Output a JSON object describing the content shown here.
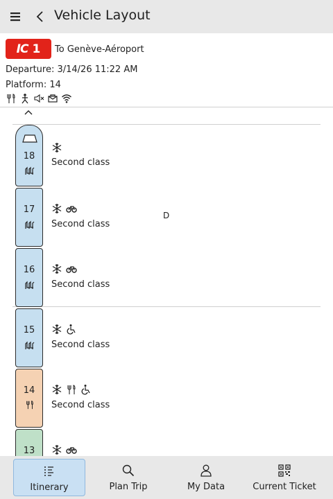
{
  "header": {
    "title": "Vehicle Layout",
    "menu_icon": "hamburger-menu-icon",
    "back_icon": "chevron-left-icon"
  },
  "train": {
    "line_logo": {
      "brand": "IC",
      "number": "1",
      "color": "#e2231a"
    },
    "destination": "To Genève-Aéroport",
    "departure": "Departure: 3/14/26 11:22 AM",
    "platform": "Platform: 14",
    "amenities": [
      "restaurant-icon",
      "family-zone-icon",
      "quiet-zone-icon",
      "business-zone-icon",
      "wifi-icon"
    ]
  },
  "sector_label": "D",
  "cars": [
    {
      "number": "18",
      "class": "Second class",
      "color": "#c6dff0",
      "icons": [
        "air-conditioning-icon"
      ],
      "car_icon": "passenger-seats-icon",
      "front": true
    },
    {
      "number": "17",
      "class": "Second class",
      "color": "#c6dff0",
      "icons": [
        "air-conditioning-icon",
        "bicycle-icon"
      ],
      "car_icon": "passenger-seats-icon"
    },
    {
      "number": "16",
      "class": "Second class",
      "color": "#c6dff0",
      "icons": [
        "air-conditioning-icon",
        "bicycle-icon"
      ],
      "car_icon": "passenger-seats-icon"
    },
    {
      "number": "15",
      "class": "Second class",
      "color": "#c6dff0",
      "icons": [
        "air-conditioning-icon",
        "wheelchair-icon"
      ],
      "car_icon": "passenger-seats-icon"
    },
    {
      "number": "14",
      "class": "Second class",
      "color": "#f5d2b3",
      "icons": [
        "air-conditioning-icon",
        "restaurant-icon",
        "wheelchair-icon"
      ],
      "car_icon": "restaurant-icon"
    },
    {
      "number": "13",
      "class": "",
      "color": "#bfe0c8",
      "icons": [
        "air-conditioning-icon",
        "bicycle-icon"
      ],
      "car_icon": ""
    }
  ],
  "nav": [
    {
      "label": "Itinerary",
      "icon": "itinerary-list-icon",
      "active": true
    },
    {
      "label": "Plan Trip",
      "icon": "search-icon",
      "active": false
    },
    {
      "label": "My Data",
      "icon": "user-icon",
      "active": false
    },
    {
      "label": "Current Ticket",
      "icon": "qr-code-icon",
      "active": false
    }
  ]
}
